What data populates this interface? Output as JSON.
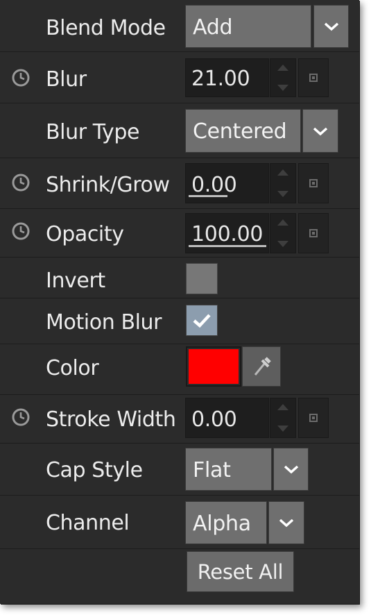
{
  "blend_mode": {
    "label": "Blend Mode",
    "value": "Add"
  },
  "blur": {
    "label": "Blur",
    "value": "21.00"
  },
  "blur_type": {
    "label": "Blur Type",
    "value": "Centered"
  },
  "shrink_grow": {
    "label": "Shrink/Grow",
    "value": "0.00"
  },
  "opacity": {
    "label": "Opacity",
    "value": "100.00"
  },
  "invert": {
    "label": "Invert",
    "checked": false
  },
  "motion_blur": {
    "label": "Motion Blur",
    "checked": true
  },
  "color": {
    "label": "Color",
    "swatch": "#ff0000"
  },
  "stroke_width": {
    "label": "Stroke Width",
    "value": "0.00"
  },
  "cap_style": {
    "label": "Cap Style",
    "value": "Flat"
  },
  "channel": {
    "label": "Channel",
    "value": "Alpha"
  },
  "reset_all": {
    "label": "Reset All"
  },
  "colors": {
    "panel_bg": "#2b2b2b",
    "field_bg": "#1e1e1e",
    "dropdown_bg": "#6f6f6f",
    "checkbox_on": "#8c9dae",
    "checkbox_off": "#777777"
  }
}
